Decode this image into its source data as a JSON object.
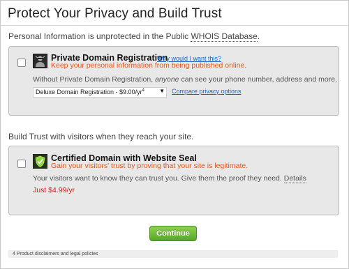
{
  "title": "Protect Your Privacy and Build Trust",
  "section1": {
    "heading_prefix": "Personal Information is unprotected in the Public ",
    "heading_whois": "WHOIS Database",
    "heading_suffix": "."
  },
  "privacy_option": {
    "title": "Private Domain Registration",
    "why_link": "Why would I want this?",
    "tagline": "Keep your personal information from being published online.",
    "desc_before": "Without Private Domain Registration, ",
    "desc_emph": "anyone",
    "desc_after": " can see your phone number, address and more.",
    "select_value": "Deluxe Domain Registration - $9.00/yr",
    "select_sup": "4",
    "compare_link": "Compare privacy options",
    "icon": "masked-person-icon"
  },
  "section2": {
    "heading": "Build Trust with visitors when they reach your site."
  },
  "certified_option": {
    "title": "Certified Domain with Website Seal",
    "tagline": "Gain your visitors' trust by proving that your site is legitimate.",
    "desc": "Your visitors want to know they can trust you. Give them the proof they need.",
    "details_link": "Details",
    "price": "Just $4.99/yr",
    "icon": "shield-check-icon"
  },
  "continue_button": "Continue",
  "footer_note": "4 Product disclaimers and legal policies",
  "colors": {
    "accent_orange": "#e2571a",
    "link_blue": "#1a63c4",
    "price_red": "#c51f1f",
    "button_green": "#6bbd3a"
  }
}
